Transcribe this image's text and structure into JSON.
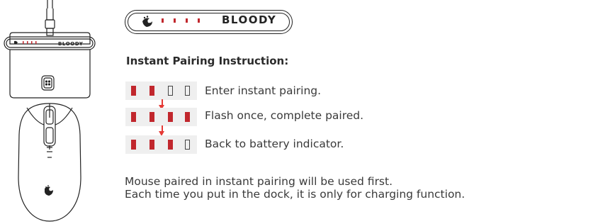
{
  "brand": {
    "wordmark": "BLOODY",
    "logo_icon": "bloody-claw-logo"
  },
  "heading": "Instant Pairing Instruction:",
  "steps": [
    {
      "leds": [
        true,
        true,
        false,
        false
      ],
      "text": "Enter instant pairing."
    },
    {
      "leds": [
        true,
        true,
        true,
        true
      ],
      "text": "Flash once, complete paired."
    },
    {
      "leds": [
        true,
        true,
        true,
        false
      ],
      "text": "Back to battery indicator."
    }
  ],
  "notes": [
    "Mouse paired in instant pairing will be used first.",
    "Each time you put in the dock, it is only for charging function."
  ],
  "colors": {
    "led_on": "#c1272d",
    "arrow": "#e53935",
    "led_row_bg": "#efefef"
  }
}
